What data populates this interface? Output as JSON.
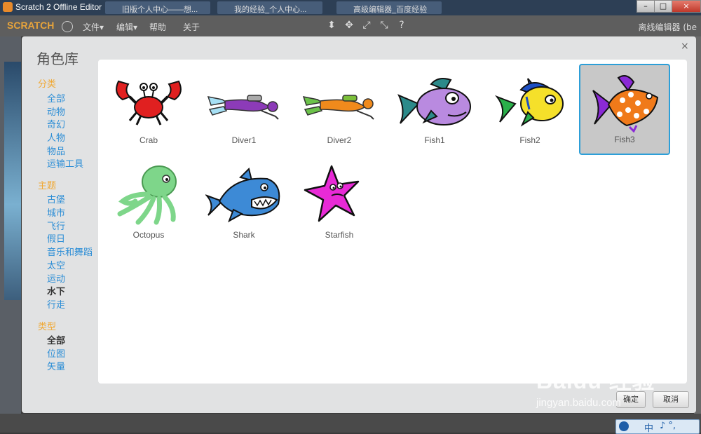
{
  "window": {
    "title": "Scratch 2 Offline Editor",
    "taskbar_tabs": [
      "旧版个人中心——想...",
      "我的经验_个人中心...",
      "高级编辑器_百度经验"
    ],
    "controls": [
      "–",
      "□",
      "×"
    ]
  },
  "menubar": {
    "logo": "SCRATCH",
    "items": [
      "文件▾",
      "编辑▾",
      "帮助",
      "关于"
    ],
    "tools": [
      "⬍",
      "✥",
      "⤢",
      "⤡",
      "?"
    ],
    "offline_label": "离线编辑器 (be"
  },
  "dialog": {
    "title": "角色库",
    "close": "×",
    "sections": [
      {
        "heading": "分类",
        "items": [
          "全部",
          "动物",
          "奇幻",
          "人物",
          "物品",
          "运输工具"
        ],
        "active": null
      },
      {
        "heading": "主题",
        "items": [
          "古堡",
          "城市",
          "飞行",
          "假日",
          "音乐和舞蹈",
          "太空",
          "运动",
          "水下",
          "行走"
        ],
        "active": "水下"
      },
      {
        "heading": "类型",
        "items": [
          "全部",
          "位图",
          "矢量"
        ],
        "active": "全部"
      }
    ],
    "sprites": [
      {
        "name": "Crab",
        "icon": "crab-icon",
        "selected": false
      },
      {
        "name": "Diver1",
        "icon": "diver-icon",
        "selected": false
      },
      {
        "name": "Diver2",
        "icon": "diver-icon",
        "selected": false
      },
      {
        "name": "Fish1",
        "icon": "fish-icon",
        "selected": false
      },
      {
        "name": "Fish2",
        "icon": "fish-icon",
        "selected": false
      },
      {
        "name": "Fish3",
        "icon": "fish-icon",
        "selected": true
      },
      {
        "name": "Octopus",
        "icon": "octopus-icon",
        "selected": false
      },
      {
        "name": "Shark",
        "icon": "shark-icon",
        "selected": false
      },
      {
        "name": "Starfish",
        "icon": "starfish-icon",
        "selected": false
      }
    ],
    "ok_label": "确定",
    "cancel_label": "取消"
  },
  "watermark": {
    "main": "Baidu 经验",
    "sub": "jingyan.baidu.com"
  },
  "ime": {
    "lang": "中",
    "marks": "♪ °,"
  },
  "colors": {
    "category": "#f0a833",
    "link": "#2b8dd6",
    "selection": "#2d9fd8"
  }
}
